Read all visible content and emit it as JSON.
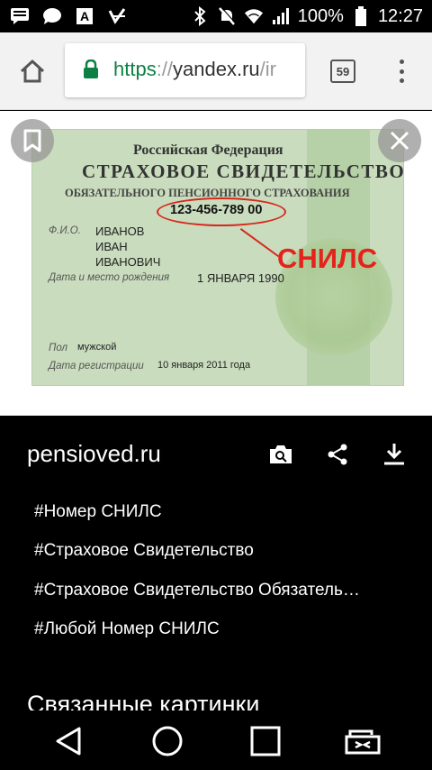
{
  "status_bar": {
    "battery": "100%",
    "time": "12:27",
    "icons": [
      "message-icon",
      "chat-icon",
      "text-a-icon",
      "checklist-icon",
      "bluetooth-icon",
      "mute-icon",
      "wifi-icon",
      "signal-icon",
      "battery-icon"
    ]
  },
  "browser": {
    "url_scheme": "https",
    "url_sep": "://",
    "url_host": "yandex.ru",
    "url_rest": "/ir",
    "tabs_count": "59"
  },
  "image": {
    "card_lines": {
      "country": "Российская Федерация",
      "title": "СТРАХОВОЕ СВИДЕТЕЛЬСТВО",
      "subtitle": "ОБЯЗАТЕЛЬНОГО ПЕНСИОННОГО СТРАХОВАНИЯ",
      "number": "123-456-789 00",
      "fio_label": "Ф.И.О.",
      "surname": "ИВАНОВ",
      "name": "ИВАН",
      "patronymic": "ИВАНОВИЧ",
      "birth_label": "Дата и место рождения",
      "birth_date": "1 ЯНВАРЯ 1990",
      "sex_label": "Пол",
      "sex": "мужской",
      "reg_label": "Дата регистрации",
      "reg_date": "10 января 2011 года",
      "overlay_label": "СНИЛС"
    }
  },
  "info": {
    "source": "pensioved.ru",
    "tags": [
      "#Номер СНИЛС",
      "#Страховое Свидетельство",
      "#Страховое Свидетельство Обязатель…",
      "#Любой Номер СНИЛС"
    ],
    "related_heading": "Связанные картинки"
  },
  "colors": {
    "url_scheme": "#0b8043",
    "snils_red": "#e4231b"
  }
}
